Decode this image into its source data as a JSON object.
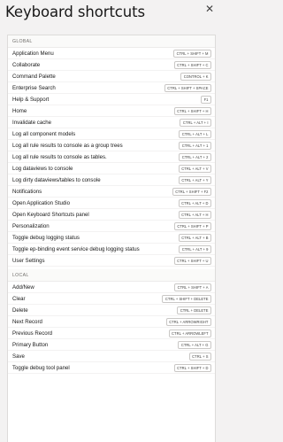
{
  "header": {
    "title": "Keyboard shortcuts",
    "close_icon": "close-icon"
  },
  "sections": {
    "global": {
      "label": "GLOBAL",
      "items": [
        {
          "label": "Application Menu",
          "keys": "CTRL + SHIFT + M"
        },
        {
          "label": "Collaborate",
          "keys": "CTRL + SHIFT + C"
        },
        {
          "label": "Command Palette",
          "keys": "CONTROL + K"
        },
        {
          "label": "Enterprise Search",
          "keys": "CTRL + SHIFT + SPACE"
        },
        {
          "label": "Help & Support",
          "keys": "F1"
        },
        {
          "label": "Home",
          "keys": "CTRL + SHIFT + H"
        },
        {
          "label": "Invalidate cache",
          "keys": "CTRL + ALT + I"
        },
        {
          "label": "Log all component models",
          "keys": "CTRL + ALT + L"
        },
        {
          "label": "Log all rule results to console as a group trees",
          "keys": "CTRL + ALT + 1"
        },
        {
          "label": "Log all rule results to console as tables.",
          "keys": "CTRL + ALT + 2"
        },
        {
          "label": "Log dataviews to console",
          "keys": "CTRL + ALT + V"
        },
        {
          "label": "Log dirty dataviews/tables to console",
          "keys": "CTRL + ALT + Y"
        },
        {
          "label": "Notifications",
          "keys": "CTRL + SHIFT + F2"
        },
        {
          "label": "Open Application Studio",
          "keys": "CTRL + ALT + D"
        },
        {
          "label": "Open Keyboard Shortcuts panel",
          "keys": "CTRL + ALT + H"
        },
        {
          "label": "Personalization",
          "keys": "CTRL + SHIFT + P"
        },
        {
          "label": "Toggle debug logging status",
          "keys": "CTRL + ALT + B"
        },
        {
          "label": "Toggle ep-binding event service debug logging status",
          "keys": "CTRL + ALT + 9"
        },
        {
          "label": "User Settings",
          "keys": "CTRL + SHIFT + U"
        }
      ]
    },
    "local": {
      "label": "LOCAL",
      "items": [
        {
          "label": "Add/New",
          "keys": "CTRL + SHIFT + A"
        },
        {
          "label": "Clear",
          "keys": "CTRL + SHIFT + DELETE"
        },
        {
          "label": "Delete",
          "keys": "CTRL + DELETE"
        },
        {
          "label": "Next Record",
          "keys": "CTRL + ARROWRIGHT"
        },
        {
          "label": "Previous Record",
          "keys": "CTRL + ARROWLEFT"
        },
        {
          "label": "Primary Button",
          "keys": "CTRL + ALT + G"
        },
        {
          "label": "Save",
          "keys": "CTRL + S"
        },
        {
          "label": "Toggle debug tool panel",
          "keys": "CTRL + SHIFT + D"
        }
      ]
    }
  }
}
